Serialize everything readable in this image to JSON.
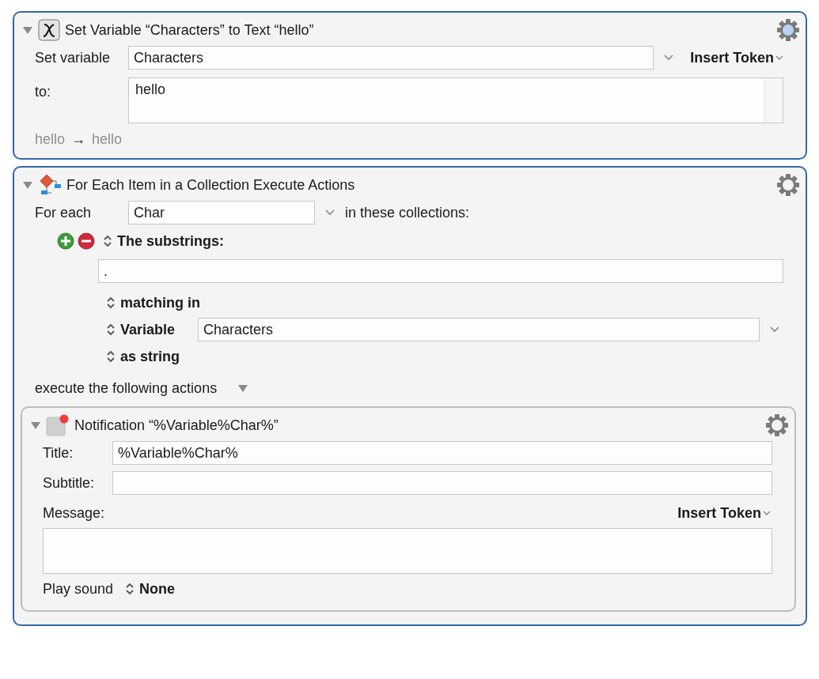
{
  "actions": [
    {
      "kind": "set_variable",
      "title": "Set Variable “Characters” to Text “hello”",
      "selected": true,
      "expanded": true,
      "gear_active": true,
      "variable_label": "Set variable",
      "variable_value": "Characters",
      "insert_token": "Insert Token",
      "to_label": "to:",
      "to_value": "hello",
      "preview_from": "hello",
      "preview_arrow": "→",
      "preview_to": "hello"
    },
    {
      "kind": "for_each",
      "title": "For Each Item in a Collection Execute Actions",
      "selected": true,
      "expanded": true,
      "gear_active": false,
      "for_each_label": "For each",
      "for_each_value": "Char",
      "collections_label": "in these collections:",
      "collection": {
        "type_label": "The substrings:",
        "pattern_value": ".",
        "matching_label": "matching in",
        "source_label": "Variable",
        "source_value": "Characters",
        "as_label": "as string"
      },
      "execute_label": "execute the following actions",
      "actions_expanded": true,
      "actions": [
        {
          "kind": "notification",
          "title": "Notification “%Variable%Char%”",
          "selected": false,
          "expanded": true,
          "gear_active": false,
          "title_label": "Title:",
          "title_value": "%Variable%Char%",
          "subtitle_label": "Subtitle:",
          "message_label": "Message:",
          "insert_token": "Insert Token",
          "sound_label": "Play sound",
          "sound_value": "None"
        }
      ]
    }
  ]
}
